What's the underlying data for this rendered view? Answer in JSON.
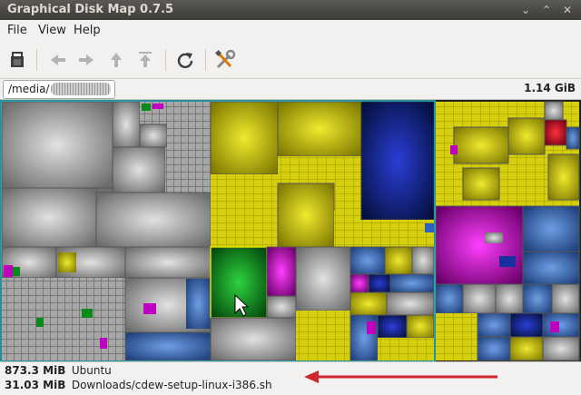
{
  "window": {
    "title": "Graphical Disk Map 0.7.5"
  },
  "window_controls": {
    "minimize": "⌄",
    "maximize": "⌃",
    "close": "✕"
  },
  "menu": {
    "file": "File",
    "view": "View",
    "help": "Help"
  },
  "toolbar": {
    "icons": [
      "open-folder-icon",
      "back-icon",
      "forward-icon",
      "up-icon",
      "top-icon",
      "refresh-icon",
      "settings-icon"
    ]
  },
  "path": {
    "prefix": "/media/",
    "total_size": "1.14 GiB"
  },
  "status": {
    "line1_size": "873.3 MiB",
    "line1_name": "Ubuntu",
    "line2_size": "31.03 MiB",
    "line2_name": "Downloads/cdew-setup-linux-i386.sh"
  },
  "colors": {
    "yellow": "#c9c200",
    "gray": "#8c8c8c",
    "blue": "#2b5fae",
    "navy": "#0a1a7a",
    "magenta": "#c000c0",
    "green": "#0a8a1a",
    "red": "#c0001a",
    "arrow": "#d0262e"
  }
}
